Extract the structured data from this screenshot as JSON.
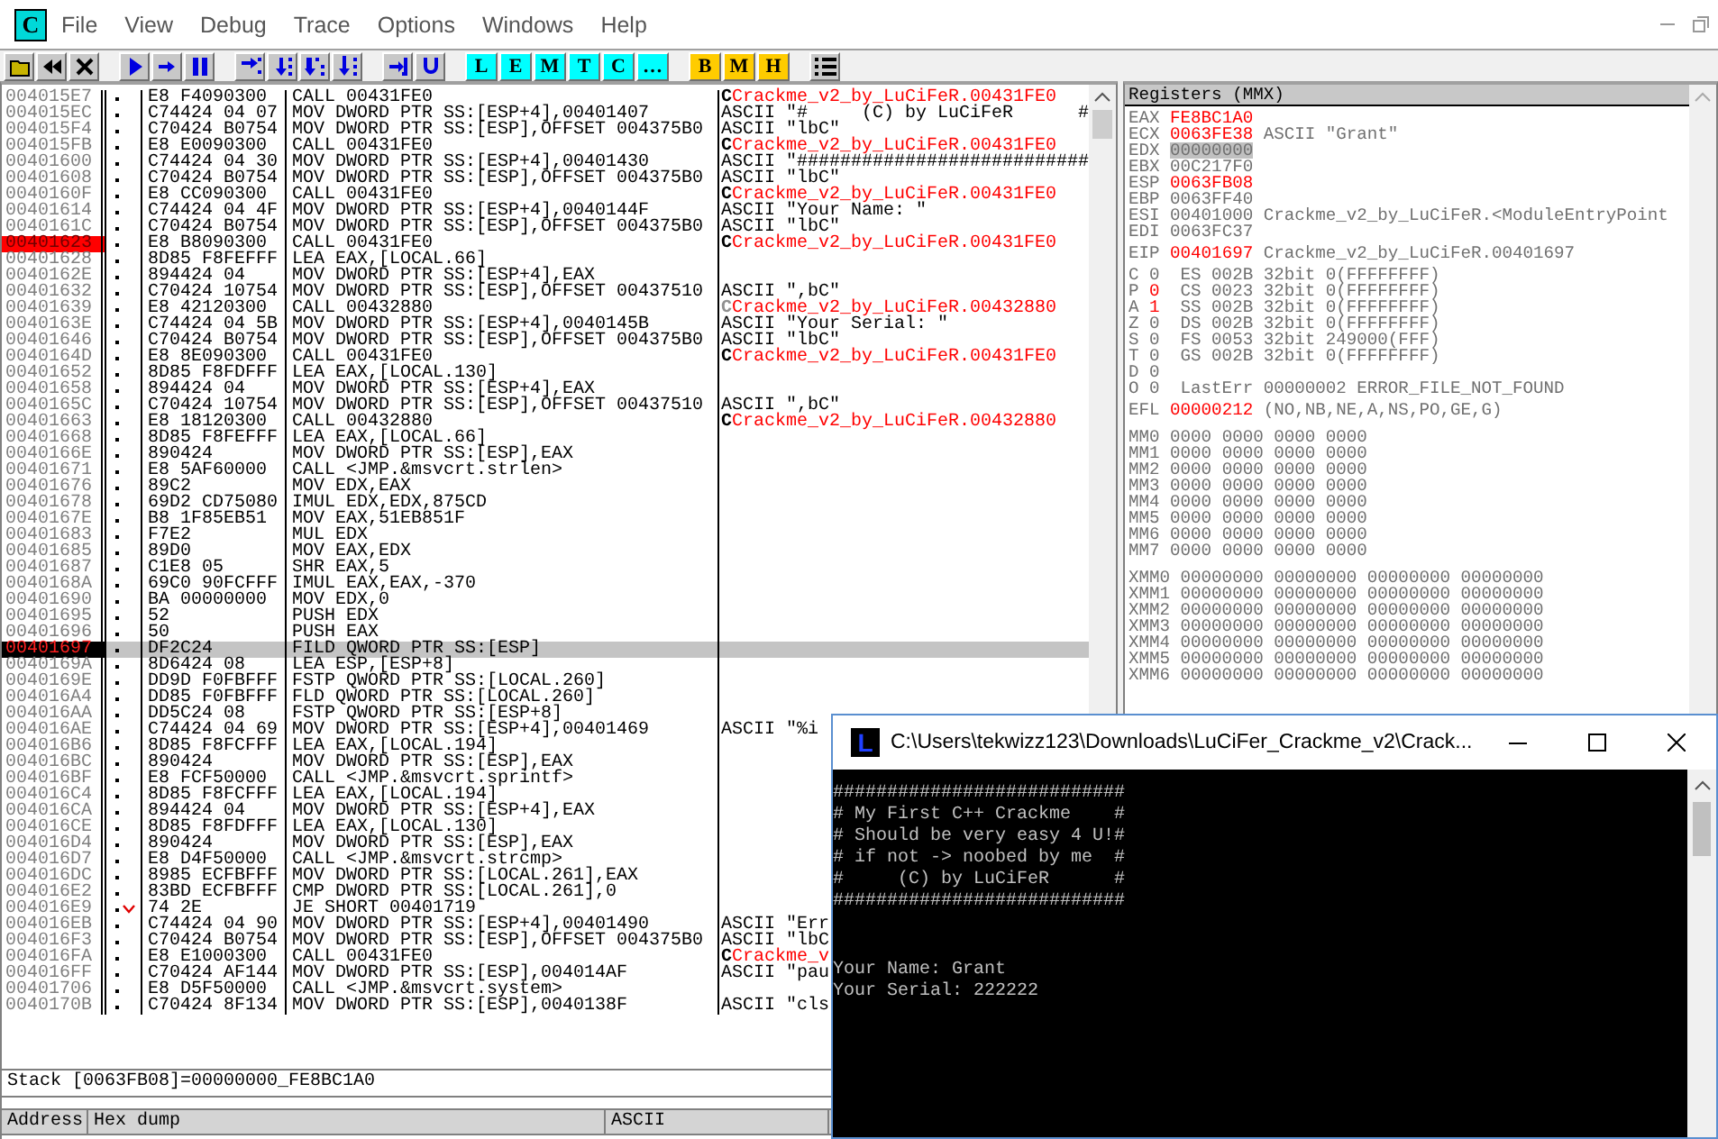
{
  "app_logo": "C",
  "menu": {
    "items": [
      "File",
      "View",
      "Debug",
      "Trace",
      "Options",
      "Windows",
      "Help"
    ]
  },
  "toolbar": {
    "letters": [
      {
        "label": "L",
        "color": "#00ffff"
      },
      {
        "label": "E",
        "color": "#00ffff"
      },
      {
        "label": "M",
        "color": "#00ffff"
      },
      {
        "label": "T",
        "color": "#00ffff"
      },
      {
        "label": "C",
        "color": "#00ffff"
      },
      {
        "label": "…",
        "color": "#00ffff"
      },
      {
        "label": "B",
        "color": "#ffcc00"
      },
      {
        "label": "M",
        "color": "#ffcc00"
      },
      {
        "label": "H",
        "color": "#ffcc00"
      }
    ]
  },
  "disassembly": {
    "rows": [
      {
        "address": "004015E7",
        "hex": "E8 F4090300",
        "code": "CALL 00431FE0",
        "breakpoint": false,
        "current": false,
        "jump": false,
        "comment": {
          "kind": "call",
          "marker": "C",
          "marker_active": true,
          "text": "Crackme_v2_by_LuCiFeR.00431FE0"
        }
      },
      {
        "address": "004015EC",
        "hex": "C74424 04 07",
        "code": "MOV DWORD PTR SS:[ESP+4],00401407",
        "breakpoint": false,
        "current": false,
        "jump": false,
        "comment": {
          "kind": "ascii",
          "text": "ASCII \"#     (C) by LuCiFeR      #"
        }
      },
      {
        "address": "004015F4",
        "hex": "C70424 B0754",
        "code": "MOV DWORD PTR SS:[ESP],OFFSET 004375B0",
        "breakpoint": false,
        "current": false,
        "jump": false,
        "comment": {
          "kind": "ascii",
          "text": "ASCII \"lbC\""
        }
      },
      {
        "address": "004015FB",
        "hex": "E8 E0090300",
        "code": "CALL 00431FE0",
        "breakpoint": false,
        "current": false,
        "jump": false,
        "comment": {
          "kind": "call",
          "marker": "C",
          "marker_active": true,
          "text": "Crackme_v2_by_LuCiFeR.00431FE0"
        }
      },
      {
        "address": "00401600",
        "hex": "C74424 04 30",
        "code": "MOV DWORD PTR SS:[ESP+4],00401430",
        "breakpoint": false,
        "current": false,
        "jump": false,
        "comment": {
          "kind": "ascii",
          "text": "ASCII \"###########################"
        }
      },
      {
        "address": "00401608",
        "hex": "C70424 B0754",
        "code": "MOV DWORD PTR SS:[ESP],OFFSET 004375B0",
        "breakpoint": false,
        "current": false,
        "jump": false,
        "comment": {
          "kind": "ascii",
          "text": "ASCII \"lbC\""
        }
      },
      {
        "address": "0040160F",
        "hex": "E8 CC090300",
        "code": "CALL 00431FE0",
        "breakpoint": false,
        "current": false,
        "jump": false,
        "comment": {
          "kind": "call",
          "marker": "C",
          "marker_active": true,
          "text": "Crackme_v2_by_LuCiFeR.00431FE0"
        }
      },
      {
        "address": "00401614",
        "hex": "C74424 04 4F",
        "code": "MOV DWORD PTR SS:[ESP+4],0040144F",
        "breakpoint": false,
        "current": false,
        "jump": false,
        "comment": {
          "kind": "ascii",
          "text": "ASCII \"Your Name: \""
        }
      },
      {
        "address": "0040161C",
        "hex": "C70424 B0754",
        "code": "MOV DWORD PTR SS:[ESP],OFFSET 004375B0",
        "breakpoint": false,
        "current": false,
        "jump": false,
        "comment": {
          "kind": "ascii",
          "text": "ASCII \"lbC\""
        }
      },
      {
        "address": "00401623",
        "hex": "E8 B8090300",
        "code": "CALL 00431FE0",
        "breakpoint": true,
        "current": false,
        "jump": false,
        "comment": {
          "kind": "call",
          "marker": "C",
          "marker_active": true,
          "text": "Crackme_v2_by_LuCiFeR.00431FE0"
        }
      },
      {
        "address": "00401628",
        "hex": "8D85 F8FEFFF",
        "code": "LEA EAX,[LOCAL.66]",
        "breakpoint": false,
        "current": false,
        "jump": false
      },
      {
        "address": "0040162E",
        "hex": "894424 04",
        "code": "MOV DWORD PTR SS:[ESP+4],EAX",
        "breakpoint": false,
        "current": false,
        "jump": false
      },
      {
        "address": "00401632",
        "hex": "C70424 10754",
        "code": "MOV DWORD PTR SS:[ESP],OFFSET 00437510",
        "breakpoint": false,
        "current": false,
        "jump": false,
        "comment": {
          "kind": "ascii",
          "text": "ASCII \",bC\""
        }
      },
      {
        "address": "00401639",
        "hex": "E8 42120300",
        "code": "CALL 00432880",
        "breakpoint": false,
        "current": false,
        "jump": false,
        "comment": {
          "kind": "call",
          "marker": "C",
          "marker_active": false,
          "text": "Crackme_v2_by_LuCiFeR.00432880"
        }
      },
      {
        "address": "0040163E",
        "hex": "C74424 04 5B",
        "code": "MOV DWORD PTR SS:[ESP+4],0040145B",
        "breakpoint": false,
        "current": false,
        "jump": false,
        "comment": {
          "kind": "ascii",
          "text": "ASCII \"Your Serial: \""
        }
      },
      {
        "address": "00401646",
        "hex": "C70424 B0754",
        "code": "MOV DWORD PTR SS:[ESP],OFFSET 004375B0",
        "breakpoint": false,
        "current": false,
        "jump": false,
        "comment": {
          "kind": "ascii",
          "text": "ASCII \"lbC\""
        }
      },
      {
        "address": "0040164D",
        "hex": "E8 8E090300",
        "code": "CALL 00431FE0",
        "breakpoint": false,
        "current": false,
        "jump": false,
        "comment": {
          "kind": "call",
          "marker": "C",
          "marker_active": true,
          "text": "Crackme_v2_by_LuCiFeR.00431FE0"
        }
      },
      {
        "address": "00401652",
        "hex": "8D85 F8FDFFF",
        "code": "LEA EAX,[LOCAL.130]",
        "breakpoint": false,
        "current": false,
        "jump": false
      },
      {
        "address": "00401658",
        "hex": "894424 04",
        "code": "MOV DWORD PTR SS:[ESP+4],EAX",
        "breakpoint": false,
        "current": false,
        "jump": false
      },
      {
        "address": "0040165C",
        "hex": "C70424 10754",
        "code": "MOV DWORD PTR SS:[ESP],OFFSET 00437510",
        "breakpoint": false,
        "current": false,
        "jump": false,
        "comment": {
          "kind": "ascii",
          "text": "ASCII \",bC\""
        }
      },
      {
        "address": "00401663",
        "hex": "E8 18120300",
        "code": "CALL 00432880",
        "breakpoint": false,
        "current": false,
        "jump": false,
        "comment": {
          "kind": "call",
          "marker": "C",
          "marker_active": true,
          "text": "Crackme_v2_by_LuCiFeR.00432880"
        }
      },
      {
        "address": "00401668",
        "hex": "8D85 F8FEFFF",
        "code": "LEA EAX,[LOCAL.66]",
        "breakpoint": false,
        "current": false,
        "jump": false
      },
      {
        "address": "0040166E",
        "hex": "890424",
        "code": "MOV DWORD PTR SS:[ESP],EAX",
        "breakpoint": false,
        "current": false,
        "jump": false
      },
      {
        "address": "00401671",
        "hex": "E8 5AF60000",
        "code": "CALL <JMP.&msvcrt.strlen>",
        "breakpoint": false,
        "current": false,
        "jump": false
      },
      {
        "address": "00401676",
        "hex": "89C2",
        "code": "MOV EDX,EAX",
        "breakpoint": false,
        "current": false,
        "jump": false
      },
      {
        "address": "00401678",
        "hex": "69D2 CD75080",
        "code": "IMUL EDX,EDX,875CD",
        "breakpoint": false,
        "current": false,
        "jump": false
      },
      {
        "address": "0040167E",
        "hex": "B8 1F85EB51",
        "code": "MOV EAX,51EB851F",
        "breakpoint": false,
        "current": false,
        "jump": false
      },
      {
        "address": "00401683",
        "hex": "F7E2",
        "code": "MUL EDX",
        "breakpoint": false,
        "current": false,
        "jump": false
      },
      {
        "address": "00401685",
        "hex": "89D0",
        "code": "MOV EAX,EDX",
        "breakpoint": false,
        "current": false,
        "jump": false
      },
      {
        "address": "00401687",
        "hex": "C1E8 05",
        "code": "SHR EAX,5",
        "breakpoint": false,
        "current": false,
        "jump": false
      },
      {
        "address": "0040168A",
        "hex": "69C0 90FCFFF",
        "code": "IMUL EAX,EAX,-370",
        "breakpoint": false,
        "current": false,
        "jump": false
      },
      {
        "address": "00401690",
        "hex": "BA 00000000",
        "code": "MOV EDX,0",
        "breakpoint": false,
        "current": false,
        "jump": false
      },
      {
        "address": "00401695",
        "hex": "52",
        "code": "PUSH EDX",
        "breakpoint": false,
        "current": false,
        "jump": false
      },
      {
        "address": "00401696",
        "hex": "50",
        "code": "PUSH EAX",
        "breakpoint": false,
        "current": false,
        "jump": false
      },
      {
        "address": "00401697",
        "hex": "DF2C24",
        "code": "FILD QWORD PTR SS:[ESP]",
        "breakpoint": false,
        "current": true,
        "jump": false
      },
      {
        "address": "0040169A",
        "hex": "8D6424 08",
        "code": "LEA ESP,[ESP+8]",
        "breakpoint": false,
        "current": false,
        "jump": false
      },
      {
        "address": "0040169E",
        "hex": "DD9D F0FBFFF",
        "code": "FSTP QWORD PTR SS:[LOCAL.260]",
        "breakpoint": false,
        "current": false,
        "jump": false
      },
      {
        "address": "004016A4",
        "hex": "DD85 F0FBFFF",
        "code": "FLD QWORD PTR SS:[LOCAL.260]",
        "breakpoint": false,
        "current": false,
        "jump": false
      },
      {
        "address": "004016AA",
        "hex": "DD5C24 08",
        "code": "FSTP QWORD PTR SS:[ESP+8]",
        "breakpoint": false,
        "current": false,
        "jump": false
      },
      {
        "address": "004016AE",
        "hex": "C74424 04 69",
        "code": "MOV DWORD PTR SS:[ESP+4],00401469",
        "breakpoint": false,
        "current": false,
        "jump": false,
        "comment": {
          "kind": "ascii",
          "text": "ASCII \"%i"
        }
      },
      {
        "address": "004016B6",
        "hex": "8D85 F8FCFFF",
        "code": "LEA EAX,[LOCAL.194]",
        "breakpoint": false,
        "current": false,
        "jump": false
      },
      {
        "address": "004016BC",
        "hex": "890424",
        "code": "MOV DWORD PTR SS:[ESP],EAX",
        "breakpoint": false,
        "current": false,
        "jump": false
      },
      {
        "address": "004016BF",
        "hex": "E8 FCF50000",
        "code": "CALL <JMP.&msvcrt.sprintf>",
        "breakpoint": false,
        "current": false,
        "jump": false
      },
      {
        "address": "004016C4",
        "hex": "8D85 F8FCFFF",
        "code": "LEA EAX,[LOCAL.194]",
        "breakpoint": false,
        "current": false,
        "jump": false
      },
      {
        "address": "004016CA",
        "hex": "894424 04",
        "code": "MOV DWORD PTR SS:[ESP+4],EAX",
        "breakpoint": false,
        "current": false,
        "jump": false
      },
      {
        "address": "004016CE",
        "hex": "8D85 F8FDFFF",
        "code": "LEA EAX,[LOCAL.130]",
        "breakpoint": false,
        "current": false,
        "jump": false
      },
      {
        "address": "004016D4",
        "hex": "890424",
        "code": "MOV DWORD PTR SS:[ESP],EAX",
        "breakpoint": false,
        "current": false,
        "jump": false
      },
      {
        "address": "004016D7",
        "hex": "E8 D4F50000",
        "code": "CALL <JMP.&msvcrt.strcmp>",
        "breakpoint": false,
        "current": false,
        "jump": false
      },
      {
        "address": "004016DC",
        "hex": "8985 ECFBFFF",
        "code": "MOV DWORD PTR SS:[LOCAL.261],EAX",
        "breakpoint": false,
        "current": false,
        "jump": false
      },
      {
        "address": "004016E2",
        "hex": "83BD ECFBFFF",
        "code": "CMP DWORD PTR SS:[LOCAL.261],0",
        "breakpoint": false,
        "current": false,
        "jump": false
      },
      {
        "address": "004016E9",
        "hex": "74 2E",
        "code": "JE SHORT 00401719",
        "breakpoint": false,
        "current": false,
        "jump": true
      },
      {
        "address": "004016EB",
        "hex": "C74424 04 90",
        "code": "MOV DWORD PTR SS:[ESP+4],00401490",
        "breakpoint": false,
        "current": false,
        "jump": false,
        "comment": {
          "kind": "ascii",
          "text": "ASCII \"Err"
        }
      },
      {
        "address": "004016F3",
        "hex": "C70424 B0754",
        "code": "MOV DWORD PTR SS:[ESP],OFFSET 004375B0",
        "breakpoint": false,
        "current": false,
        "jump": false,
        "comment": {
          "kind": "ascii",
          "text": "ASCII \"lbC"
        }
      },
      {
        "address": "004016FA",
        "hex": "E8 E1000300",
        "code": "CALL 00431FE0",
        "breakpoint": false,
        "current": false,
        "jump": false,
        "comment": {
          "kind": "call",
          "marker": "C",
          "marker_active": true,
          "text": "Crackme_v"
        }
      },
      {
        "address": "004016FF",
        "hex": "C70424 AF144",
        "code": "MOV DWORD PTR SS:[ESP],004014AF",
        "breakpoint": false,
        "current": false,
        "jump": false,
        "comment": {
          "kind": "ascii",
          "text": "ASCII \"pau"
        }
      },
      {
        "address": "00401706",
        "hex": "E8 D5F50000",
        "code": "CALL <JMP.&msvcrt.system>",
        "breakpoint": false,
        "current": false,
        "jump": false
      },
      {
        "address": "0040170B",
        "hex": "C70424 8F134",
        "code": "MOV DWORD PTR SS:[ESP],0040138F",
        "breakpoint": false,
        "current": false,
        "jump": false,
        "comment": {
          "kind": "ascii",
          "text": "ASCII \"cls"
        }
      }
    ]
  },
  "registers": {
    "title": "Registers (MMX)",
    "groups": [
      {
        "kind": "general",
        "lines": [
          {
            "name": "EAX",
            "value": "FE8BC1A0",
            "changed": true,
            "selected": false
          },
          {
            "name": "ECX",
            "value": "0063FE38",
            "changed": true,
            "selected": false,
            "note": "ASCII \"Grant\""
          },
          {
            "name": "EDX",
            "value": "00000000",
            "changed": false,
            "selected": true
          },
          {
            "name": "EBX",
            "value": "00C217F0",
            "changed": false,
            "selected": false
          },
          {
            "name": "ESP",
            "value": "0063FB08",
            "changed": true,
            "selected": false
          },
          {
            "name": "EBP",
            "value": "0063FF40",
            "changed": false,
            "selected": false
          },
          {
            "name": "ESI",
            "value": "00401000",
            "changed": false,
            "selected": false,
            "note": "Crackme_v2_by_LuCiFeR.<ModuleEntryPoint"
          },
          {
            "name": "EDI",
            "value": "0063FC37",
            "changed": false,
            "selected": false
          }
        ]
      },
      {
        "kind": "eip",
        "lines": [
          {
            "name": "EIP",
            "value": "00401697",
            "changed": true,
            "note": "Crackme_v2_by_LuCiFeR.00401697"
          }
        ]
      },
      {
        "kind": "flags",
        "lines": [
          {
            "name": "C",
            "value": "0",
            "changed": false,
            "note": "ES 002B 32bit 0(FFFFFFFF)"
          },
          {
            "name": "P",
            "value": "0",
            "changed": true,
            "note": "CS 0023 32bit 0(FFFFFFFF)"
          },
          {
            "name": "A",
            "value": "1",
            "changed": true,
            "note": "SS 002B 32bit 0(FFFFFFFF)"
          },
          {
            "name": "Z",
            "value": "0",
            "changed": false,
            "note": "DS 002B 32bit 0(FFFFFFFF)"
          },
          {
            "name": "S",
            "value": "0",
            "changed": false,
            "note": "FS 0053 32bit 249000(FFF)"
          },
          {
            "name": "T",
            "value": "0",
            "changed": false,
            "note": "GS 002B 32bit 0(FFFFFFFF)"
          },
          {
            "name": "D",
            "value": "0",
            "changed": false
          },
          {
            "name": "O",
            "value": "0",
            "changed": false,
            "note": "LastErr 00000002 ERROR_FILE_NOT_FOUND"
          }
        ]
      },
      {
        "kind": "efl",
        "lines": [
          {
            "name": "EFL",
            "value": "00000212",
            "changed": true,
            "note": "(NO,NB,NE,A,NS,PO,GE,G)"
          }
        ]
      },
      {
        "kind": "mmx",
        "lines": [
          {
            "name": "MM0",
            "value": "0000 0000 0000 0000",
            "changed": false
          },
          {
            "name": "MM1",
            "value": "0000 0000 0000 0000",
            "changed": false
          },
          {
            "name": "MM2",
            "value": "0000 0000 0000 0000",
            "changed": false
          },
          {
            "name": "MM3",
            "value": "0000 0000 0000 0000",
            "changed": false
          },
          {
            "name": "MM4",
            "value": "0000 0000 0000 0000",
            "changed": false
          },
          {
            "name": "MM5",
            "value": "0000 0000 0000 0000",
            "changed": false
          },
          {
            "name": "MM6",
            "value": "0000 0000 0000 0000",
            "changed": false
          },
          {
            "name": "MM7",
            "value": "0000 0000 0000 0000",
            "changed": false
          }
        ]
      },
      {
        "kind": "xmm",
        "lines": [
          {
            "name": "XMM0",
            "value": "00000000 00000000 00000000 00000000",
            "changed": false
          },
          {
            "name": "XMM1",
            "value": "00000000 00000000 00000000 00000000",
            "changed": false
          },
          {
            "name": "XMM2",
            "value": "00000000 00000000 00000000 00000000",
            "changed": false
          },
          {
            "name": "XMM3",
            "value": "00000000 00000000 00000000 00000000",
            "changed": false
          },
          {
            "name": "XMM4",
            "value": "00000000 00000000 00000000 00000000",
            "changed": false
          },
          {
            "name": "XMM5",
            "value": "00000000 00000000 00000000 00000000",
            "changed": false
          },
          {
            "name": "XMM6",
            "value": "00000000 00000000 00000000 00000000",
            "changed": false
          }
        ]
      }
    ]
  },
  "stack_info": "Stack [0063FB08]=00000000_FE8BC1A0",
  "dump": {
    "columns": [
      "Address",
      "Hex dump",
      "ASCII"
    ]
  },
  "console": {
    "logo": "L",
    "title": "C:\\Users\\tekwizz123\\Downloads\\LuCiFer_Crackme_v2\\Crack...",
    "banner": [
      "###########################",
      "# My First C++ Crackme    #",
      "# Should be very easy 4 U!#",
      "# if not -> noobed by me  #",
      "#     (C) by LuCiFeR      #",
      "###########################"
    ],
    "prompts": [
      "Your Name: Grant",
      "Your Serial: 222222"
    ]
  }
}
